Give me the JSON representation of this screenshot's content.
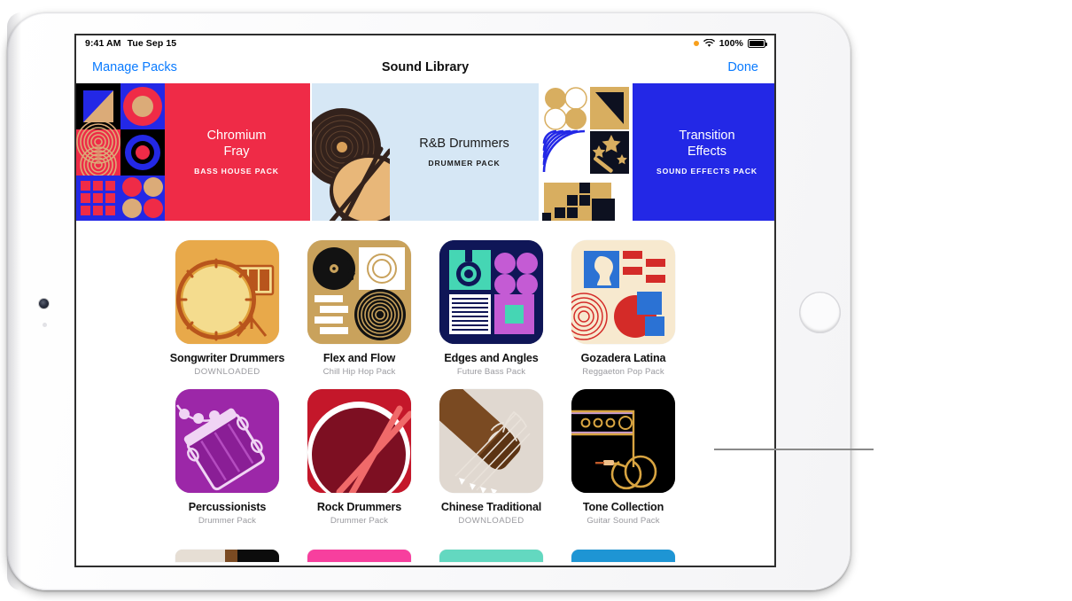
{
  "status_bar": {
    "time": "9:41 AM",
    "date": "Tue Sep 15",
    "battery_percent": "100%",
    "icons": [
      "record-dot-icon",
      "wifi-icon",
      "battery-icon"
    ]
  },
  "nav_bar": {
    "left_button": "Manage Packs",
    "title": "Sound Library",
    "right_button": "Done"
  },
  "banners": [
    {
      "title_line1": "Chromium",
      "title_line2": "Fray",
      "subtitle": "BASS HOUSE PACK",
      "bg": "#ef2b47",
      "text_color": "#ffffff"
    },
    {
      "title_line1": "R&B Drummers",
      "title_line2": "",
      "subtitle": "DRUMMER PACK",
      "bg": "#d6e7f5",
      "text_color": "#1b1b1b"
    },
    {
      "title_line1": "Transition",
      "title_line2": "Effects",
      "subtitle": "SOUND EFFECTS PACK",
      "bg": "#2328e6",
      "text_color": "#ffffff"
    }
  ],
  "packs": [
    {
      "name": "Songwriter Drummers",
      "subtitle": "DOWNLOADED",
      "downloaded": true,
      "bg": "#e8a94a"
    },
    {
      "name": "Flex and Flow",
      "subtitle": "Chill Hip Hop Pack",
      "downloaded": false,
      "bg": "#c9a25c"
    },
    {
      "name": "Edges and Angles",
      "subtitle": "Future Bass Pack",
      "downloaded": false,
      "bg": "#0f1657"
    },
    {
      "name": "Gozadera Latina",
      "subtitle": "Reggaeton Pop Pack",
      "downloaded": false,
      "bg": "#f7e9cf"
    },
    {
      "name": "Percussionists",
      "subtitle": "Drummer Pack",
      "downloaded": false,
      "bg": "#9c27a8"
    },
    {
      "name": "Rock Drummers",
      "subtitle": "Drummer Pack",
      "downloaded": false,
      "bg": "#c4172a"
    },
    {
      "name": "Chinese Traditional",
      "subtitle": "DOWNLOADED",
      "downloaded": true,
      "bg": "#e0d8d0"
    },
    {
      "name": "Tone Collection",
      "subtitle": "Guitar Sound Pack",
      "downloaded": false,
      "bg": "#000000"
    }
  ],
  "partial_row_colors": [
    "#d8cfc4",
    "#f73f9e",
    "#63d8c0",
    "#1e95d4"
  ],
  "colors": {
    "accent_blue": "#0a7bff",
    "subtitle_gray": "#9a9a9f",
    "screen_bg": "#ffffff",
    "callout_line": "#8a8a8a"
  }
}
